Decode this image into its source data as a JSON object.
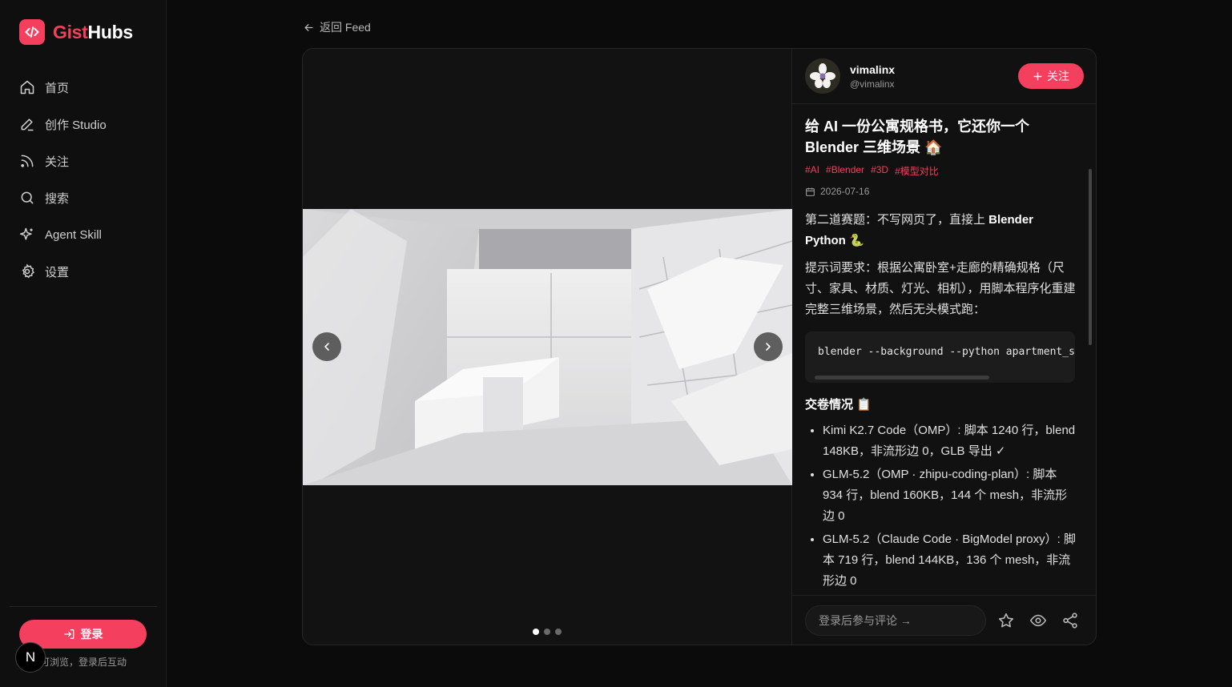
{
  "app": {
    "logo_part1": "Gist",
    "logo_part2": "Hubs",
    "brand_color": "#f43f5e"
  },
  "sidebar": {
    "items": [
      {
        "label": "首页",
        "icon": "home-icon"
      },
      {
        "label": "创作 Studio",
        "icon": "pen-icon"
      },
      {
        "label": "关注",
        "icon": "rss-icon"
      },
      {
        "label": "搜索",
        "icon": "search-icon"
      },
      {
        "label": "Agent Skill",
        "icon": "sparkles-icon"
      },
      {
        "label": "设置",
        "icon": "gear-icon"
      }
    ],
    "login_label": "登录",
    "login_hint": "可浏览，登录后互动",
    "badge_letter": "N"
  },
  "back_link": "返回 Feed",
  "post": {
    "author_name": "vimalinx",
    "author_handle": "@vimalinx",
    "follow_label": "关注",
    "title": "给 AI 一份公寓规格书，它还你一个 Blender 三维场景 🏠",
    "tags": [
      "#AI",
      "#Blender",
      "#3D",
      "#模型对比"
    ],
    "date": "2026-07-16",
    "intro_prefix": "第二道赛题：不写网页了，直接上 ",
    "intro_bold": "Blender Python",
    "intro_suffix": " 🐍",
    "prompt_text": "提示词要求：根据公寓卧室+走廊的精确规格（尺寸、家具、材质、灯光、相机），用脚本程序化重建完整三维场景，然后无头模式跑：",
    "code": "blender --background --python apartment_scene.py",
    "results_heading": "交卷情况 📋",
    "results": [
      "Kimi K2.7 Code（OMP）: 脚本 1240 行，blend 148KB，非流形边 0，GLB 导出 ✓",
      "GLM-5.2（OMP · zhipu-coding-plan）: 脚本 934 行，blend 160KB，144 个 mesh，非流形边 0",
      "GLM-5.2（Claude Code · BigModel proxy）: 脚本 719 行，blend 144KB，136 个 mesh，非流形边 0"
    ],
    "comment_placeholder": "登录后参与评论 →",
    "carousel_count": 3,
    "carousel_active": 0
  }
}
